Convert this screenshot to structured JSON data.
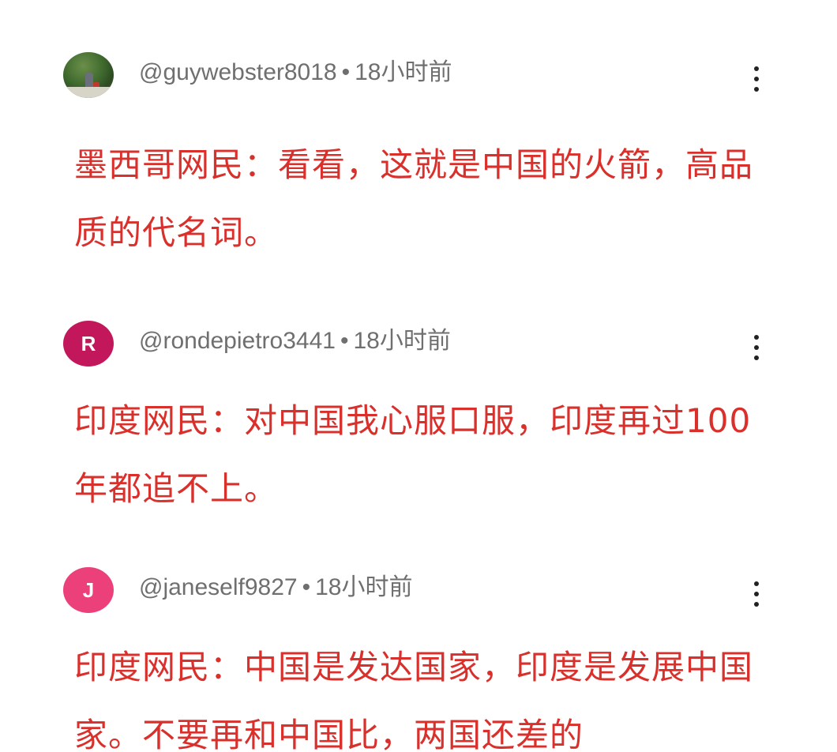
{
  "comments": [
    {
      "handle": "@guywebster8018",
      "separator": "•",
      "time": "18小时前",
      "avatar_type": "photo",
      "avatar_letter": "",
      "avatar_color": "#3f6a2e",
      "text": "墨西哥网民：看看，这就是中国的火箭，高品质的代名词。"
    },
    {
      "handle": "@rondepietro3441",
      "separator": "•",
      "time": "18小时前",
      "avatar_type": "letter",
      "avatar_letter": "R",
      "avatar_color": "#c2185b",
      "text": "印度网民：对中国我心服口服，印度再过100年都追不上。"
    },
    {
      "handle": "@janeself9827",
      "separator": "•",
      "time": "18小时前",
      "avatar_type": "letter",
      "avatar_letter": "J",
      "avatar_color": "#ec407a",
      "text": "印度网民：中国是发达国家，印度是发展中国家。不要再和中国比，两国还差的"
    }
  ],
  "colors": {
    "comment_text": "#d9302c",
    "meta_text": "#6f6f6f",
    "background": "#ffffff"
  },
  "icons": {
    "more": "more-vertical-icon"
  }
}
